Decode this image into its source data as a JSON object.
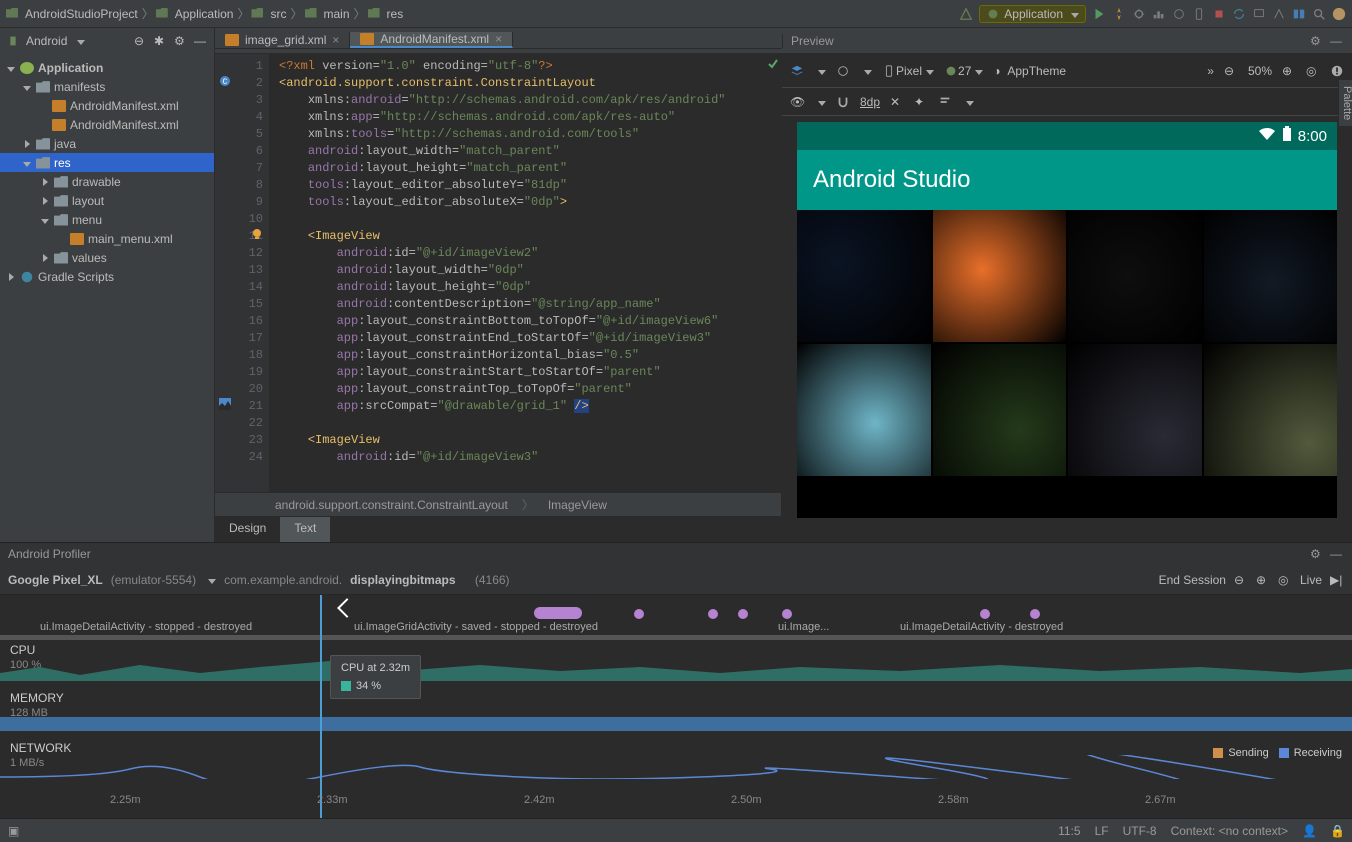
{
  "breadcrumbs": [
    "AndroidStudioProject",
    "Application",
    "src",
    "main",
    "res"
  ],
  "runConfig": "Application",
  "projectHeader": "Android",
  "tabs": [
    {
      "name": "image_grid.xml",
      "active": false
    },
    {
      "name": "AndroidManifest.xml",
      "active": true
    }
  ],
  "previewHeader": "Preview",
  "tree": {
    "app": "Application",
    "manifests": "manifests",
    "am1": "AndroidManifest.xml",
    "am2": "AndroidManifest.xml",
    "java": "java",
    "res": "res",
    "drawable": "drawable",
    "layout": "layout",
    "menu": "menu",
    "mainmenu": "main_menu.xml",
    "values": "values",
    "gradle": "Gradle Scripts"
  },
  "code": {
    "lines": [
      1,
      2,
      3,
      4,
      5,
      6,
      7,
      8,
      9,
      10,
      11,
      12,
      13,
      14,
      15,
      16,
      17,
      18,
      19,
      20,
      21,
      22,
      23,
      24
    ],
    "l1_a": "<?xml ",
    "l1_b": "version=",
    "l1_c": "\"1.0\" ",
    "l1_d": "encoding=",
    "l1_e": "\"utf-8\"",
    "l1_f": "?>",
    "l2": "<android.support.constraint.ConstraintLayout",
    "l3_a": "xmlns:",
    "l3_b": "android",
    "l3_c": "=",
    "l3_d": "\"http://schemas.android.com/apk/res/android\"",
    "l4_a": "xmlns:",
    "l4_b": "app",
    "l4_c": "=",
    "l4_d": "\"http://schemas.android.com/apk/res-auto\"",
    "l5_a": "xmlns:",
    "l5_b": "tools",
    "l5_c": "=",
    "l5_d": "\"http://schemas.android.com/tools\"",
    "l6_a": "android",
    "l6_b": ":layout_width",
    "l6_c": "=",
    "l6_d": "\"match_parent\"",
    "l7_a": "android",
    "l7_b": ":layout_height",
    "l7_c": "=",
    "l7_d": "\"match_parent\"",
    "l8_a": "tools",
    "l8_b": ":layout_editor_absoluteY",
    "l8_c": "=",
    "l8_d": "\"81dp\"",
    "l9_a": "tools",
    "l9_b": ":layout_editor_absoluteX",
    "l9_c": "=",
    "l9_d": "\"0dp\"",
    "l9_e": ">",
    "l11": "<ImageView",
    "l12_a": "android",
    "l12_b": ":id",
    "l12_c": "=",
    "l12_d": "\"@+id/imageView2\"",
    "l13_a": "android",
    "l13_b": ":layout_width",
    "l13_c": "=",
    "l13_d": "\"0dp\"",
    "l14_a": "android",
    "l14_b": ":layout_height",
    "l14_c": "=",
    "l14_d": "\"0dp\"",
    "l15_a": "android",
    "l15_b": ":contentDescription",
    "l15_c": "=",
    "l15_d": "\"@string/app_name\"",
    "l16_a": "app",
    "l16_b": ":layout_constraintBottom_toTopOf",
    "l16_c": "=",
    "l16_d": "\"@+id/imageView6\"",
    "l17_a": "app",
    "l17_b": ":layout_constraintEnd_toStartOf",
    "l17_c": "=",
    "l17_d": "\"@+id/imageView3\"",
    "l18_a": "app",
    "l18_b": ":layout_constraintHorizontal_bias",
    "l18_c": "=",
    "l18_d": "\"0.5\"",
    "l19_a": "app",
    "l19_b": ":layout_constraintStart_toStartOf",
    "l19_c": "=",
    "l19_d": "\"parent\"",
    "l20_a": "app",
    "l20_b": ":layout_constraintTop_toTopOf",
    "l20_c": "=",
    "l20_d": "\"parent\"",
    "l21_a": "app",
    "l21_b": ":srcCompat",
    "l21_c": "=",
    "l21_d": "\"@drawable/grid_1\" ",
    "l21_e": "/>",
    "l23": "<ImageView",
    "l24_a": "android",
    "l24_b": ":id",
    "l24_c": "=",
    "l24_d": "\"@+id/imageView3\""
  },
  "crumbBar": {
    "a": "android.support.constraint.ConstraintLayout",
    "b": "ImageView"
  },
  "designTabs": {
    "design": "Design",
    "text": "Text"
  },
  "pvToolbar": {
    "device": "Pixel",
    "api": "27",
    "theme": "AppTheme",
    "zoom": "50%",
    "dp": "8dp"
  },
  "preview": {
    "clock": "8:00",
    "title": "Android Studio"
  },
  "gridColors": [
    "#0b1424",
    "#e86f2a",
    "#0e0e0e",
    "#121a25",
    "#6fb5c7",
    "#243a1a",
    "#2a2a35",
    "#525a3c",
    "#30d030",
    "#ff0060",
    "#2a2a35",
    "#525a3c"
  ],
  "profiler": {
    "title": "Android Profiler",
    "device": "Google Pixel_XL",
    "emu": "(emulator-5554)",
    "pkgPre": "com.example.android.",
    "pkgBold": "displayingbitmaps",
    "pid": "(4166)",
    "end": "End Session",
    "live": "Live",
    "ev1": "ui.ImageDetailActivity - stopped - destroyed",
    "ev2": "ui.ImageGridActivity - saved - stopped - destroyed",
    "ev3": "ui.Image...",
    "ev4": "ui.ImageDetailActivity - destroyed",
    "cpu": "CPU",
    "cpuSub": "100 %",
    "mem": "MEMORY",
    "memSub": "128 MB",
    "net": "NETWORK",
    "netSub": "1 MB/s",
    "tipTitle": "CPU at 2.32m",
    "tipVal": "34 %",
    "legSend": "Sending",
    "legRecv": "Receiving",
    "ticks": [
      "2.25m",
      "2.33m",
      "2.42m",
      "2.50m",
      "2.58m",
      "2.67m"
    ]
  },
  "status": {
    "pos": "11:5",
    "lf": "LF",
    "enc": "UTF-8",
    "ctx": "Context: <no context>"
  }
}
